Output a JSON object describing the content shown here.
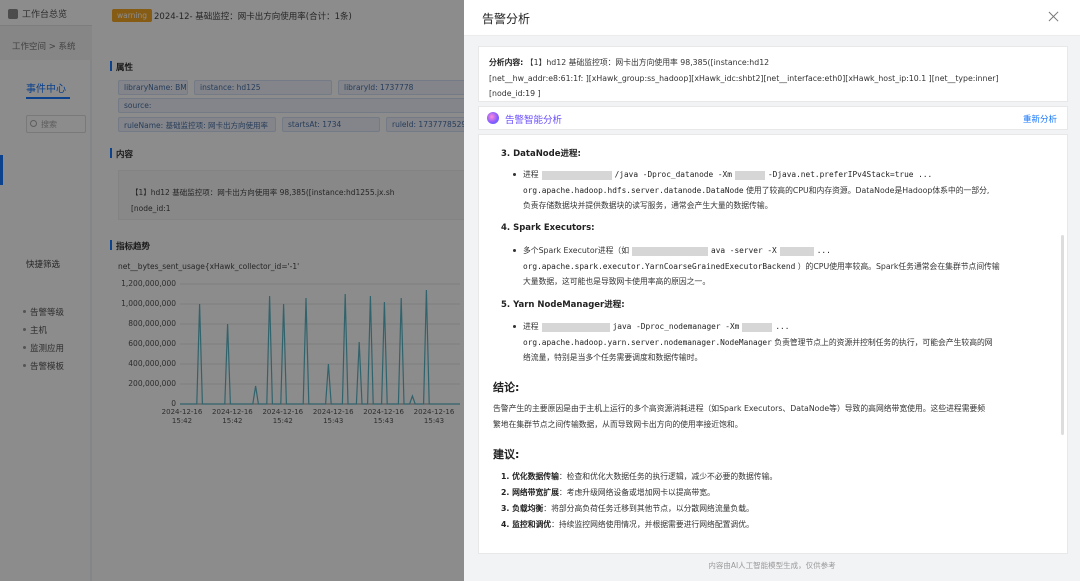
{
  "app": {
    "title": "工作台总览",
    "breadcrumb": "工作空间  >  系统"
  },
  "nav": {
    "tab": "事件中心",
    "search_placeholder": "搜索",
    "quick_filter_title": "快捷筛选",
    "quick_items": [
      "告警等级",
      "主机",
      "监测应用",
      "告警模板"
    ]
  },
  "event": {
    "level_badge": "warning",
    "headline": "2024-12-          基础监控：网卡出方向使用率(合计：1条)",
    "section_attrs": "属性",
    "tags": [
      "libraryName: BM",
      "instance: hd125",
      "libraryId: 1737778",
      "source:",
      "ruleName: 基础监控项: 网卡出方向使用率",
      "startsAt: 1734",
      "ruleId: 1737778529"
    ],
    "section_content": "内容",
    "content_line1": "【1】hd12          基础监控项：网卡出方向使用率 98,385([instance:hd1255.jx.sh",
    "content_line2": "[node_id:1",
    "section_trend": "指标趋势",
    "metric_name": "net__bytes_sent_usage{xHawk_collector_id='-1'"
  },
  "chart_data": {
    "type": "line",
    "title": "",
    "xlabel": "",
    "ylabel": "",
    "y_tick_labels": [
      "1,200,000,000",
      "1,000,000,000",
      "800,000,000",
      "600,000,000",
      "400,000,000",
      "200,000,000",
      "0"
    ],
    "ylim": [
      0,
      1200000000
    ],
    "x_tick_labels": [
      [
        "2024-12-16",
        "15:42"
      ],
      [
        "2024-12-16",
        "15:42"
      ],
      [
        "2024-12-16",
        "15:42"
      ],
      [
        "2024-12-16",
        "15:43"
      ],
      [
        "2024-12-16",
        "15:43"
      ],
      [
        "2024-12-16",
        "15:43"
      ]
    ],
    "grid": true,
    "series": [
      {
        "color": "#5ab4c5",
        "x": [
          0,
          6,
          7,
          8,
          10,
          16,
          17,
          18,
          20,
          26,
          27,
          28,
          31,
          32,
          33,
          36,
          37,
          38,
          40,
          44,
          45,
          46,
          52,
          53,
          54,
          58,
          59,
          60,
          63,
          64,
          65,
          67,
          68,
          69,
          72,
          73,
          74,
          78,
          79,
          80,
          82,
          83,
          84,
          87,
          88,
          89,
          100
        ],
        "y": [
          0,
          0,
          1000000000,
          0,
          0,
          0,
          800000000,
          0,
          0,
          0,
          180000000,
          0,
          0,
          1080000000,
          0,
          0,
          1000000000,
          0,
          0,
          0,
          1060000000,
          0,
          0,
          400000000,
          0,
          0,
          1100000000,
          0,
          0,
          620000000,
          0,
          0,
          1080000000,
          0,
          0,
          1020000000,
          0,
          0,
          1060000000,
          0,
          0,
          80000000,
          0,
          0,
          1140000000,
          0,
          0
        ]
      }
    ]
  },
  "drawer": {
    "title": "告警分析",
    "analysis_label": "分析内容:",
    "analysis_line1": "【1】hd12              基础监控项：网卡出方向使用率 98,385([instance:hd12",
    "analysis_line2": "[net__hw_addr:e8:61:1f:          ][xHawk_group:ss_hadoop][xHawk_idc:shbt2][net__interface:eth0][xHawk_host_ip:10.1          ][net__type:inner]",
    "analysis_line3": "[node_id:19          ]",
    "ai_title": "告警智能分析",
    "reanalyze": "重新分析",
    "s3_title": "3. DataNode进程:",
    "s3_cmd_a": "进程",
    "s3_cmd_b": "/java -Dproc_datanode -Xm",
    "s3_cmd_c": "-Djava.net.preferIPv4Stack=true ...",
    "s3_cls": "org.apache.hadoop.hdfs.server.datanode.DataNode",
    "s3_desc1": " 使用了较高的CPU和内存资源。DataNode是Hadoop体系中的一部分,",
    "s3_desc2": "负责存储数据块并提供数据块的读写服务，通常会产生大量的数据传输。",
    "s4_title": "4. Spark Executors:",
    "s4_a": "多个Spark Executor进程（如",
    "s4_b": "ava -server -X",
    "s4_c": "...",
    "s4_cls": "org.apache.spark.executor.YarnCoarseGrainedExecutorBackend",
    "s4_desc1": " ）的CPU使用率较高。Spark任务通常会在集群节点间传输",
    "s4_desc2": "大量数据，这可能也是导致网卡使用率高的原因之一。",
    "s5_title": "5. Yarn NodeManager进程:",
    "s5_a": "进程",
    "s5_b": "java -Dproc_nodemanager -Xm",
    "s5_c": "...",
    "s5_cls": "org.apache.hadoop.yarn.server.nodemanager.NodeManager",
    "s5_desc1": " 负责管理节点上的资源并控制任务的执行，可能会产生较高的网",
    "s5_desc2": "络流量，特别是当多个任务需要调度和数据传输时。",
    "conclusion_title": "结论:",
    "conclusion_1": "告警产生的主要原因是由于主机上运行的多个高资源消耗进程（如Spark Executors、DataNode等）导致的高网络带宽使用。这些进程需要频",
    "conclusion_2": "繁地在集群节点之间传输数据，从而导致网卡出方向的使用率接近饱和。",
    "advice_title": "建议:",
    "advice": [
      {
        "k": "1. 优化数据传输",
        "v": "：检查和优化大数据任务的执行逻辑，减少不必要的数据传输。"
      },
      {
        "k": "2. 网络带宽扩展",
        "v": "：考虑升级网络设备或增加网卡以提高带宽。"
      },
      {
        "k": "3. 负载均衡",
        "v": "：将部分高负荷任务迁移到其他节点，以分散网络流量负载。"
      },
      {
        "k": "4. 监控和调优",
        "v": "：持续监控网络使用情况，并根据需要进行网络配置调优。"
      }
    ],
    "footer": "内容由AI人工智能模型生成，仅供参考"
  }
}
